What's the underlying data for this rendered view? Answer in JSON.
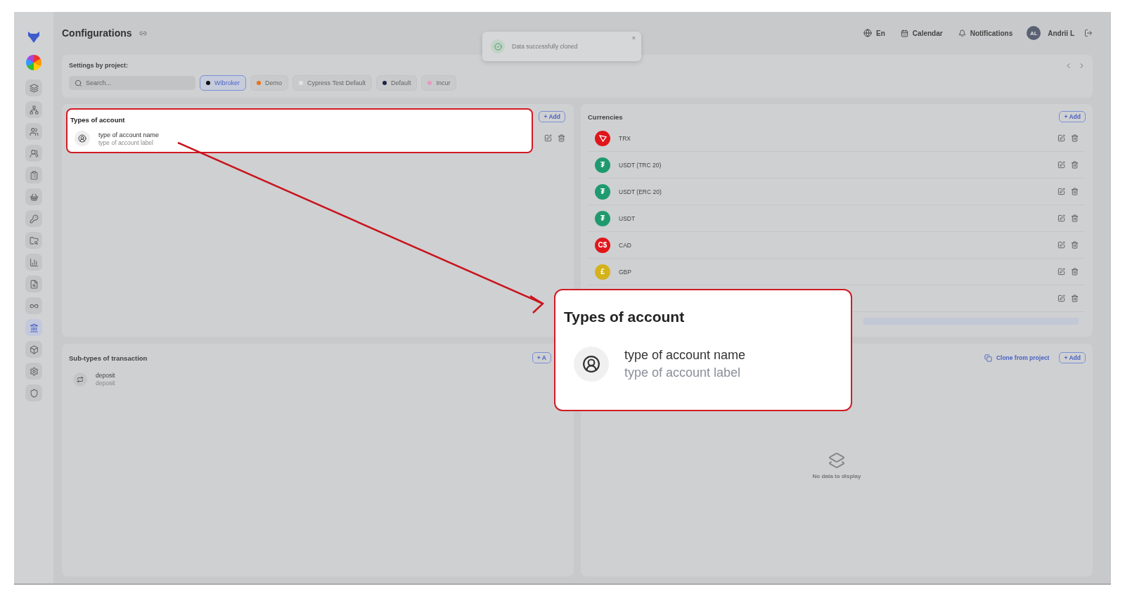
{
  "sidebar": {
    "items": [
      {
        "selected": false
      },
      {
        "selected": false
      },
      {
        "selected": false
      },
      {
        "selected": false
      },
      {
        "selected": false
      },
      {
        "selected": false
      },
      {
        "selected": false
      },
      {
        "selected": false
      },
      {
        "selected": false
      },
      {
        "selected": false
      },
      {
        "selected": false
      },
      {
        "selected": true
      },
      {
        "selected": false
      },
      {
        "selected": false
      },
      {
        "selected": false
      }
    ]
  },
  "header": {
    "title": "Configurations",
    "language": "En",
    "calendar": "Calendar",
    "notifications": "Notifications",
    "avatar": "AL",
    "user": "Andrii L"
  },
  "toast": {
    "message": "Data successfully cloned",
    "close": "×"
  },
  "settings": {
    "label": "Settings by project:",
    "search": {
      "placeholder": "Search..."
    },
    "projects": [
      {
        "label": "Wibroker",
        "color": "#111111",
        "selected": true
      },
      {
        "label": "Demo",
        "color": "#e8731a",
        "selected": false
      },
      {
        "label": "Cypress Test Default",
        "color": "#e2e3e5",
        "selected": false
      },
      {
        "label": "Default",
        "color": "#1d2547",
        "selected": false
      },
      {
        "label": "Incur",
        "color": "#e59ac0",
        "selected": false
      }
    ]
  },
  "types_of_account": {
    "title": "Types of account",
    "add": "+ Add",
    "items": [
      {
        "name": "type of account name",
        "label": "type of account label"
      }
    ]
  },
  "currencies": {
    "title": "Currencies",
    "add": "+ Add",
    "items": [
      {
        "kind": "tron",
        "name": "TRX",
        "color": "#e0161b"
      },
      {
        "kind": "symbol",
        "symbol": "₮",
        "name": "USDT (TRC 20)",
        "color": "#1f9a6f"
      },
      {
        "kind": "symbol",
        "symbol": "₮",
        "name": "USDT (ERC 20)",
        "color": "#1f9a6f"
      },
      {
        "kind": "symbol",
        "symbol": "₮",
        "name": "USDT",
        "color": "#1f9a6f"
      },
      {
        "kind": "symbol",
        "symbol": "C$",
        "name": "CAD",
        "color": "#e0161b"
      },
      {
        "kind": "symbol",
        "symbol": "£",
        "name": "GBP",
        "color": "#d4b21a"
      },
      {
        "kind": "hidden"
      }
    ]
  },
  "sub_types": {
    "title": "Sub-types of transaction",
    "add": "+ A",
    "items": [
      {
        "name": "deposit",
        "label": "deposit"
      }
    ]
  },
  "right_bottom": {
    "clone": "Clone from project",
    "add": "+ Add",
    "empty": "No data to display"
  },
  "zoom_callout": {
    "title": "Types of account",
    "name": "type of account name",
    "label": "type of account label"
  }
}
